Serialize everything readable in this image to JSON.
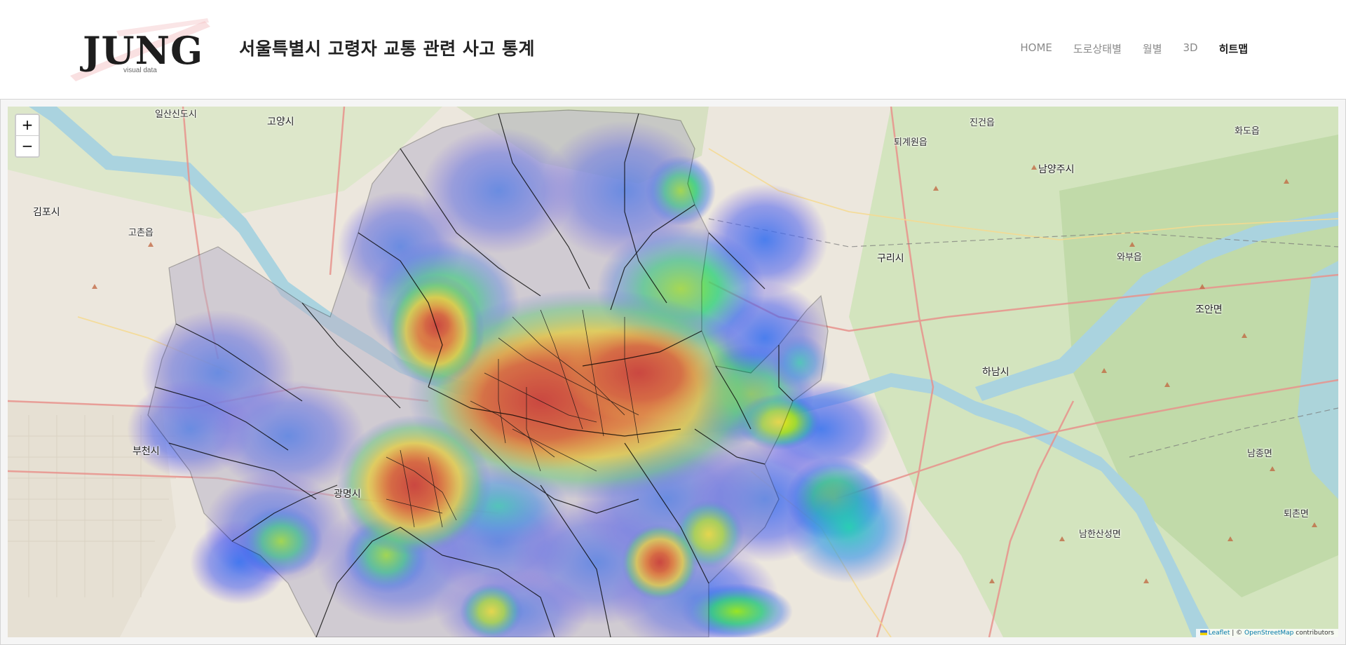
{
  "brand": {
    "logo_word": "JUNG",
    "logo_sub": "visual data"
  },
  "page": {
    "title": "서울특별시 고령자 교통 관련 사고 통계"
  },
  "nav": {
    "items": [
      {
        "label": "HOME",
        "active": false
      },
      {
        "label": "도로상태별",
        "active": false
      },
      {
        "label": "월별",
        "active": false
      },
      {
        "label": "3D",
        "active": false
      },
      {
        "label": "히트맵",
        "active": true
      }
    ]
  },
  "map": {
    "zoom_in_label": "+",
    "zoom_out_label": "−",
    "attribution": {
      "leaflet": "Leaflet",
      "separator": " | © ",
      "osm": "OpenStreetMap",
      "suffix": " contributors"
    },
    "places": [
      "일산신도시",
      "고양시",
      "진건읍",
      "화도읍",
      "퇴계원읍",
      "남양주시",
      "김포시",
      "고촌읍",
      "구리시",
      "와부읍",
      "조안면",
      "하남시",
      "부천시",
      "광명시",
      "남한산성면",
      "남종면",
      "퇴촌면"
    ],
    "heat_colors": [
      "#0000ff",
      "#00ffff",
      "#00ff00",
      "#ffff00",
      "#ff0000"
    ]
  }
}
